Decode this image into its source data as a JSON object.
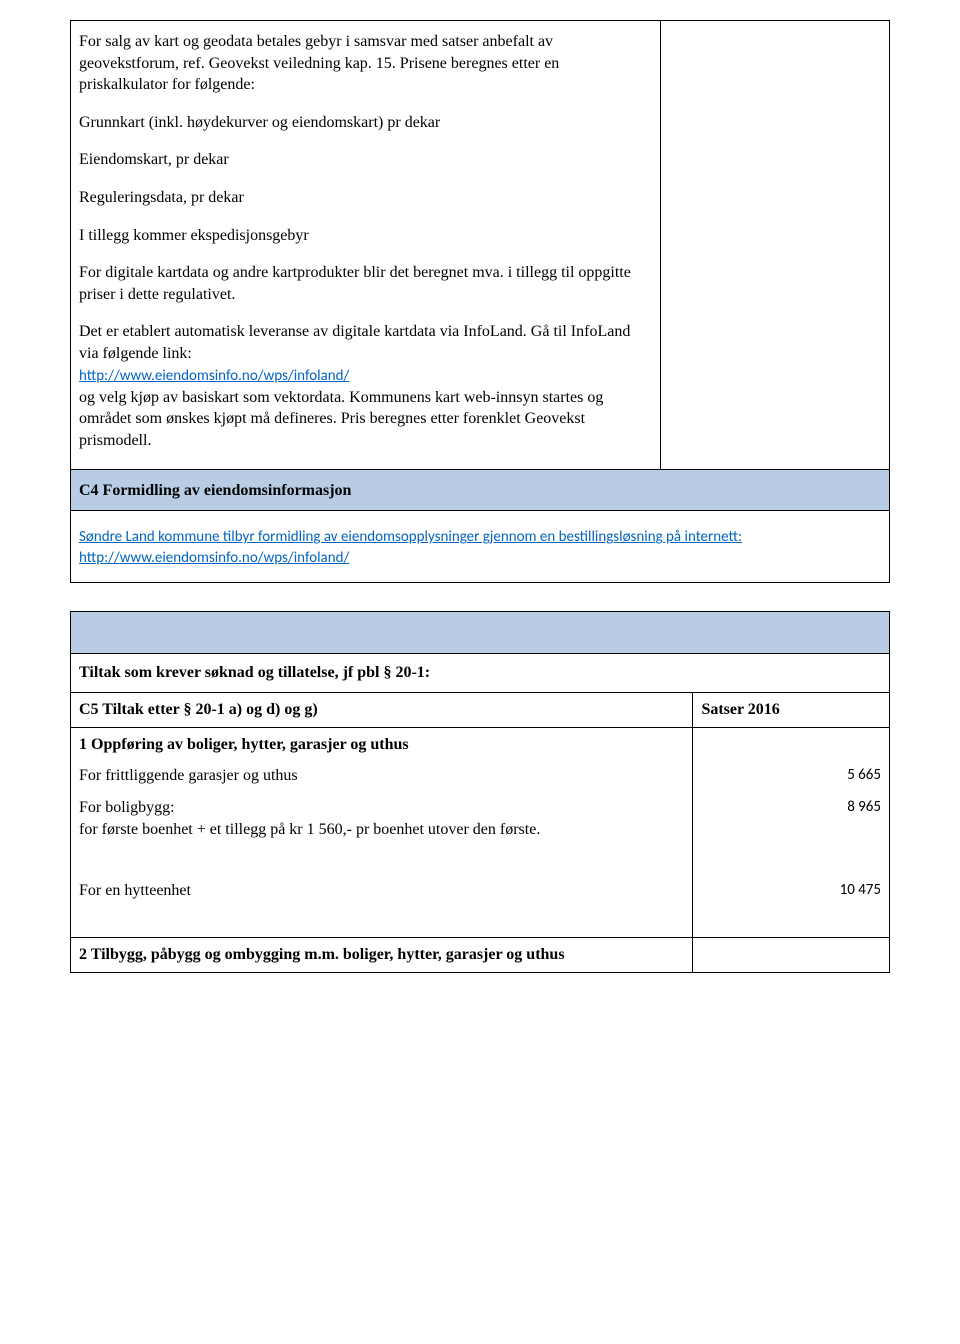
{
  "block1": {
    "para1": "For salg av kart og geodata betales gebyr i samsvar med satser anbefalt av geovekstforum, ref. Geovekst veiledning kap. 15. Prisene beregnes etter en priskalkulator for følgende:",
    "line1": "Grunnkart (inkl. høydekurver og eiendomskart) pr dekar",
    "line2": "Eiendomskart, pr dekar",
    "line3": "Reguleringsdata, pr dekar",
    "line4": "I tillegg kommer ekspedisjonsgebyr",
    "para2": "For digitale kartdata og andre kartprodukter blir det beregnet mva. i tillegg til oppgitte priser i dette regulativet.",
    "para3": "Det er etablert automatisk leveranse av digitale kartdata via InfoLand. Gå til InfoLand via følgende link:",
    "link1": "http://www.eiendomsinfo.no/wps/infoland/",
    "para4": "og velg kjøp av basiskart som vektordata. Kommunens kart web-innsyn startes og området som ønskes kjøpt må defineres. Pris beregnes etter forenklet Geovekst prismodell."
  },
  "section_c4": {
    "title": "C4 Formidling av eiendomsinformasjon",
    "link_text": "Søndre Land kommune tilbyr formidling av eiendomsopplysninger gjennom en bestillingsløsning på internett: http://www.eiendomsinfo.no/wps/infoland/"
  },
  "section_tiltak": {
    "title": "Tiltak som krever søknad og tillatelse, jf pbl § 20-1:",
    "c5_left": "C5 Tiltak etter § 20-1 a) og d) og g)",
    "c5_right": "Satser 2016",
    "row1_bold": "1 Oppføring av boliger, hytter, garasjer og uthus",
    "row_fritt": "For frittliggende garasjer og uthus",
    "val_fritt": "5 665",
    "row_bolig_l1": "For boligbygg:",
    "row_bolig_l2": "for første boenhet + et tillegg på kr 1 560,- pr boenhet utover den første.",
    "val_bolig": "8 965",
    "row_hytte": "For en hytteenhet",
    "val_hytte": "10 475",
    "row2_bold": "2 Tilbygg, påbygg og ombygging m.m. boliger, hytter, garasjer og uthus"
  }
}
